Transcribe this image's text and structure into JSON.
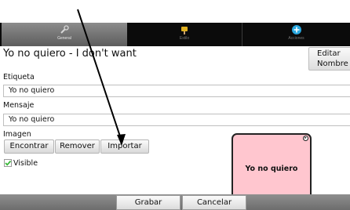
{
  "tabs": [
    {
      "label": "General",
      "icon": "wrench-icon",
      "active": true
    },
    {
      "label": "Estilo",
      "icon": "paint-icon",
      "active": false
    },
    {
      "label": "Acciones",
      "icon": "plus-circle-icon",
      "active": false
    }
  ],
  "header": {
    "title": "Yo no quiero - I don't want",
    "edit_name_line1": "Editar",
    "edit_name_line2": "Nombre"
  },
  "form": {
    "label_label": "Etiqueta",
    "label_value": "Yo no quiero",
    "message_label": "Mensaje",
    "message_value": "Yo no quiero",
    "image_label": "Imagen",
    "find_button": "Encontrar",
    "remove_button": "Remover",
    "import_button": "Importar",
    "visible_label": "Visible",
    "visible_checked": true
  },
  "preview": {
    "text": "Yo no quiero",
    "background": "#ffc6cf"
  },
  "footer": {
    "save_button": "Grabar",
    "cancel_button": "Cancelar"
  }
}
